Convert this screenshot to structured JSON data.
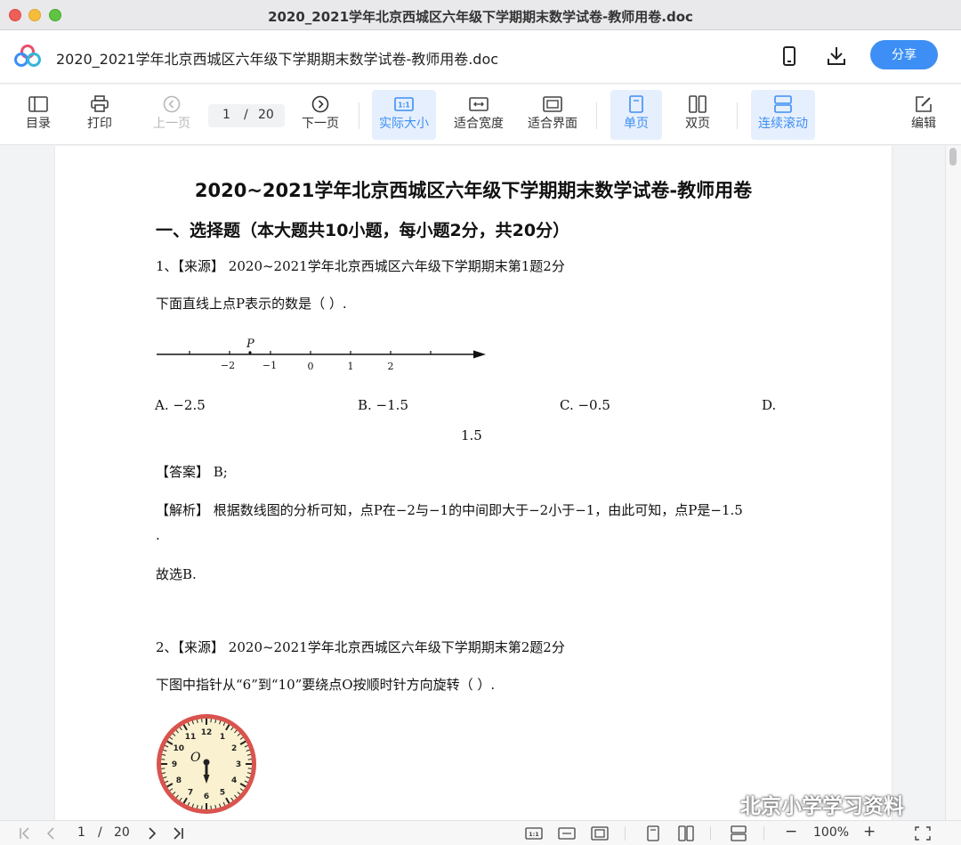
{
  "window": {
    "title": "2020_2021学年北京西城区六年级下学期期末数学试卷-教师用卷.doc"
  },
  "header": {
    "doc_title": "2020_2021学年北京西城区六年级下学期期末数学试卷-教师用卷.doc",
    "share_label": "分享",
    "icons": [
      "app-logo-icon",
      "mobile-icon",
      "download-icon"
    ]
  },
  "toolbar": {
    "toc": "目录",
    "print": "打印",
    "prev": "上一页",
    "page_current": "1",
    "page_sep": "/",
    "page_total": "20",
    "next": "下一页",
    "actual_size": "实际大小",
    "fit_width": "适合宽度",
    "fit_screen": "适合界面",
    "single": "单页",
    "double": "双页",
    "continuous": "连续滚动",
    "edit": "编辑",
    "actual_size_icon_text": "1:1"
  },
  "document": {
    "title": "2020~2021学年北京西城区六年级下学期期末数学试卷-教师用卷",
    "section1": "一、选择题（本大题共10小题，每小题2分，共20分）",
    "q1": {
      "source": "1、【来源】 2020~2021学年北京西城区六年级下学期期末第1题2分",
      "stem": "下面直线上点P表示的数是（    ）.",
      "numberline": {
        "point_label": "P",
        "ticks": [
          "−2",
          "−1",
          "0",
          "1",
          "2"
        ]
      },
      "option_a": "A.  −2.5",
      "option_b": "B.  −1.5",
      "option_c": "C.  −0.5",
      "option_d": "D.",
      "option_d_value": "1.5",
      "answer": "【答案】 B;",
      "analysis": "【解析】 根据数线图的分析可知，点P在−2与−1的中间即大于−2小于−1，由此可知，点P是−1.5",
      "analysis_dot": ".",
      "conclusion": "故选B."
    },
    "q2": {
      "source": "2、【来源】 2020~2021学年北京西城区六年级下学期期末第2题2分",
      "stem": "下图中指针从“6”到“10”要绕点O按顺时针方向旋转（    ）.",
      "clock_center_label": "O",
      "clock_numbers": [
        "12",
        "1",
        "2",
        "3",
        "4",
        "5",
        "6",
        "7",
        "8",
        "9",
        "10",
        "11"
      ]
    }
  },
  "statusbar": {
    "page_current": "1",
    "page_sep": "/",
    "page_total": "20",
    "zoom_minus": "−",
    "zoom": "100%",
    "zoom_plus": "+"
  },
  "watermark": {
    "text": "北京小学学习资料"
  },
  "colors": {
    "accent": "#3d8ff5",
    "active_bg": "#e6effd",
    "clock_ring": "#d9534f"
  }
}
